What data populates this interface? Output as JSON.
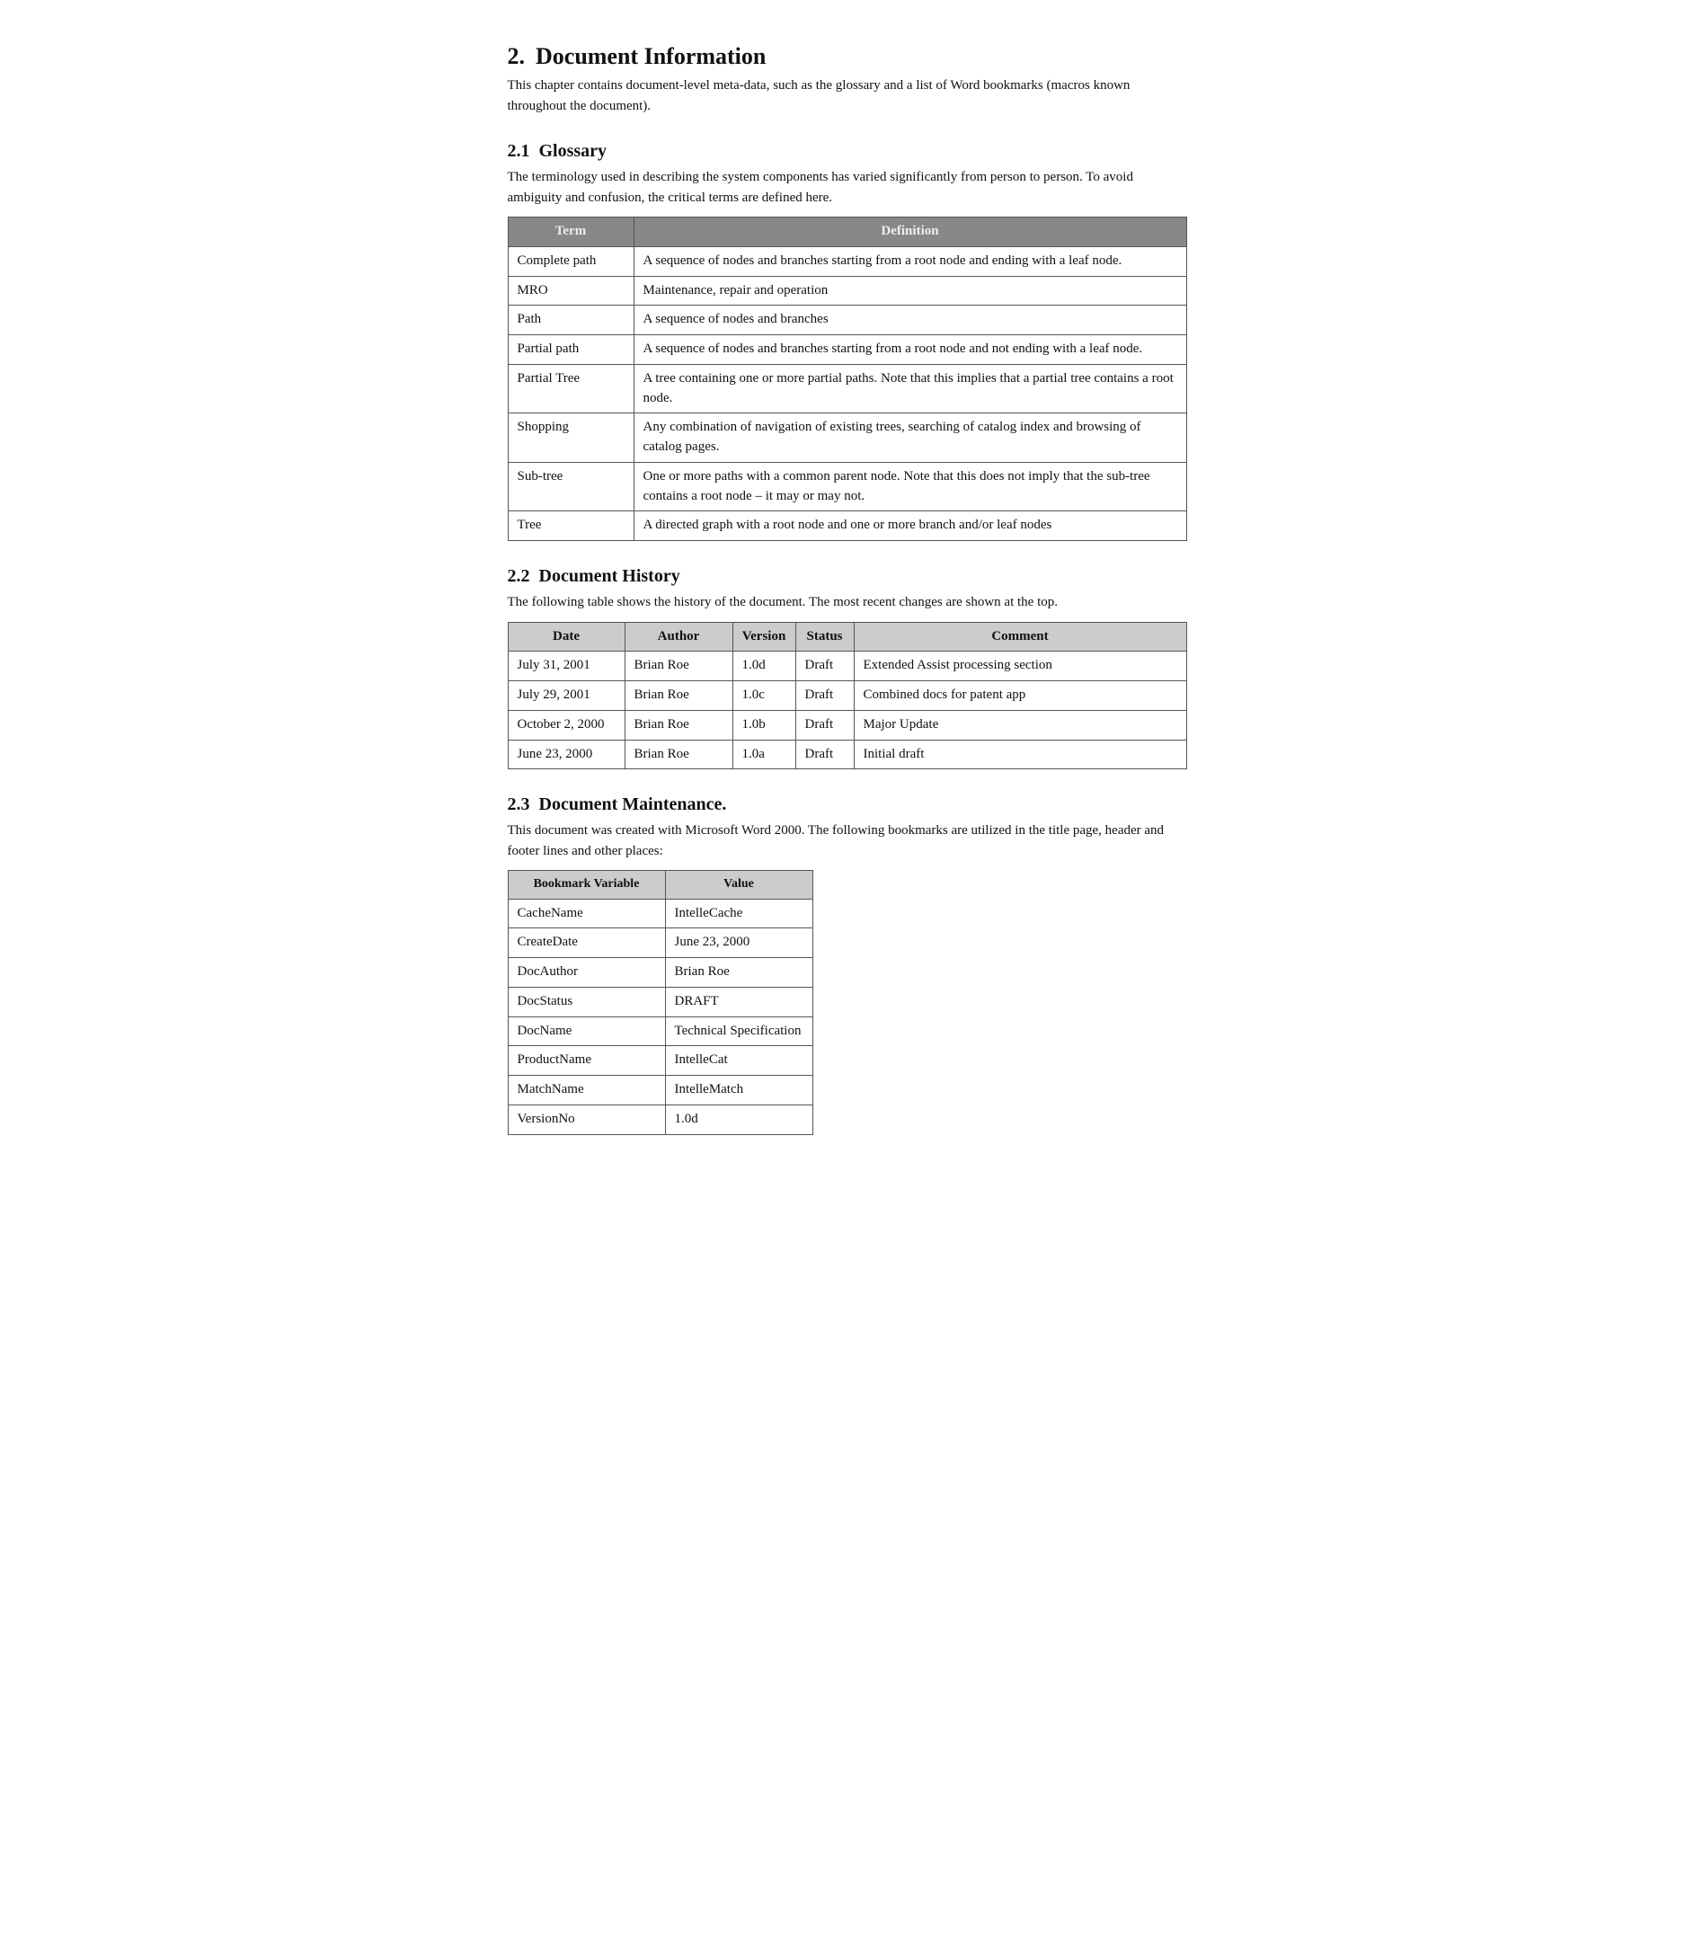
{
  "page": {
    "section2": {
      "number": "2.",
      "title": "Document Information",
      "intro": "This chapter contains document-level meta-data, such as the glossary and a list of Word bookmarks (macros known throughout the document)."
    },
    "section2_1": {
      "number": "2.1",
      "title": "Glossary",
      "intro": "The terminology used in describing the system components has varied significantly from person to person.  To avoid ambiguity and confusion, the critical terms are defined here.",
      "table_headers": [
        "Term",
        "Definition"
      ],
      "rows": [
        {
          "term": "Complete path",
          "definition": "A sequence of nodes and branches starting from a root node and ending with a leaf node."
        },
        {
          "term": "MRO",
          "definition": "Maintenance, repair and operation"
        },
        {
          "term": "Path",
          "definition": "A sequence of nodes and branches"
        },
        {
          "term": "Partial path",
          "definition": "A sequence of nodes and branches starting from a root node and not ending with a leaf node."
        },
        {
          "term": "Partial Tree",
          "definition": "A tree containing one or more partial paths.  Note that this implies that a partial tree contains a root node."
        },
        {
          "term": "Shopping",
          "definition": "Any combination of navigation of existing trees, searching of catalog index and browsing of catalog pages."
        },
        {
          "term": "Sub-tree",
          "definition": "One or more paths with a common parent node.  Note that this does not imply that the sub-tree contains a root node – it may or may not."
        },
        {
          "term": "Tree",
          "definition": "A directed graph with a root node and one or more branch and/or leaf nodes"
        }
      ]
    },
    "section2_2": {
      "number": "2.2",
      "title": "Document History",
      "intro": "The following table shows the history of the document.  The most recent changes are shown at the top.",
      "table_headers": [
        "Date",
        "Author",
        "Version",
        "Status",
        "Comment"
      ],
      "rows": [
        {
          "date": "July 31, 2001",
          "author": "Brian Roe",
          "version": "1.0d",
          "status": "Draft",
          "comment": "Extended Assist processing section"
        },
        {
          "date": "July 29, 2001",
          "author": "Brian Roe",
          "version": "1.0c",
          "status": "Draft",
          "comment": "Combined docs for patent app"
        },
        {
          "date": "October 2, 2000",
          "author": "Brian Roe",
          "version": "1.0b",
          "status": "Draft",
          "comment": "Major Update"
        },
        {
          "date": "June 23, 2000",
          "author": "Brian Roe",
          "version": "1.0a",
          "status": "Draft",
          "comment": "Initial draft"
        }
      ]
    },
    "section2_3": {
      "number": "2.3",
      "title": "Document Maintenance.",
      "intro": "This document was created with Microsoft Word 2000. The following bookmarks are utilized in the title page, header and footer lines and other places:",
      "table_headers": [
        "Bookmark Variable",
        "Value"
      ],
      "rows": [
        {
          "bookmark": "CacheName",
          "value": "IntelleCache"
        },
        {
          "bookmark": "CreateDate",
          "value": "June 23, 2000"
        },
        {
          "bookmark": "DocAuthor",
          "value": "Brian Roe"
        },
        {
          "bookmark": "DocStatus",
          "value": "DRAFT"
        },
        {
          "bookmark": "DocName",
          "value": "Technical Specification"
        },
        {
          "bookmark": "ProductName",
          "value": "IntelleCat"
        },
        {
          "bookmark": "MatchName",
          "value": "IntelleMatch"
        },
        {
          "bookmark": "VersionNo",
          "value": "1.0d"
        }
      ]
    }
  }
}
